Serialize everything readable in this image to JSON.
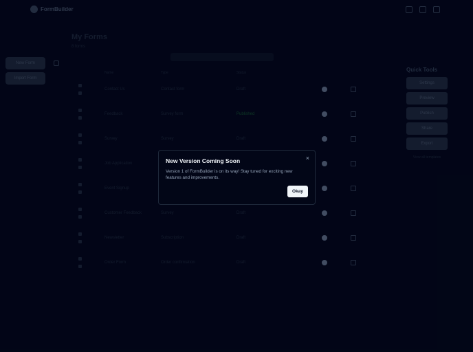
{
  "app": {
    "brand": "FormBuilder"
  },
  "page": {
    "title": "My Forms",
    "subtitle": "8 forms"
  },
  "left": {
    "buttons": [
      "New Form",
      "Import Form"
    ]
  },
  "tabs": {
    "label": "",
    "items": [
      "",
      "",
      ""
    ]
  },
  "table": {
    "headers": [
      "",
      "Name",
      "Type",
      "Status",
      "",
      "",
      ""
    ],
    "rows": [
      {
        "name": "Contact Us",
        "type": "Contact form",
        "status": "Draft"
      },
      {
        "name": "Feedback",
        "type": "Survey form",
        "status": "Published"
      },
      {
        "name": "Survey",
        "type": "Survey",
        "status": "Draft"
      },
      {
        "name": "Job Application",
        "type": "",
        "status": ""
      },
      {
        "name": "Event Signup",
        "type": "",
        "status": ""
      },
      {
        "name": "Customer Feedback",
        "type": "Survey",
        "status": "Draft"
      },
      {
        "name": "Newsletter",
        "type": "Subscription",
        "status": "Draft"
      },
      {
        "name": "Order Form",
        "type": "Order confirmation",
        "status": "Draft"
      }
    ]
  },
  "right_panel": {
    "title": "Quick Tools",
    "buttons": [
      "Settings",
      "Preview",
      "Publish",
      "Share",
      "Export"
    ],
    "footer": "View all templates"
  },
  "modal": {
    "title": "New Version Coming Soon",
    "close_symbol": "×",
    "body": "Version 1 of FormBuilder is on its way! Stay tuned for exciting new features and improvements.",
    "ok_label": "Okay"
  }
}
